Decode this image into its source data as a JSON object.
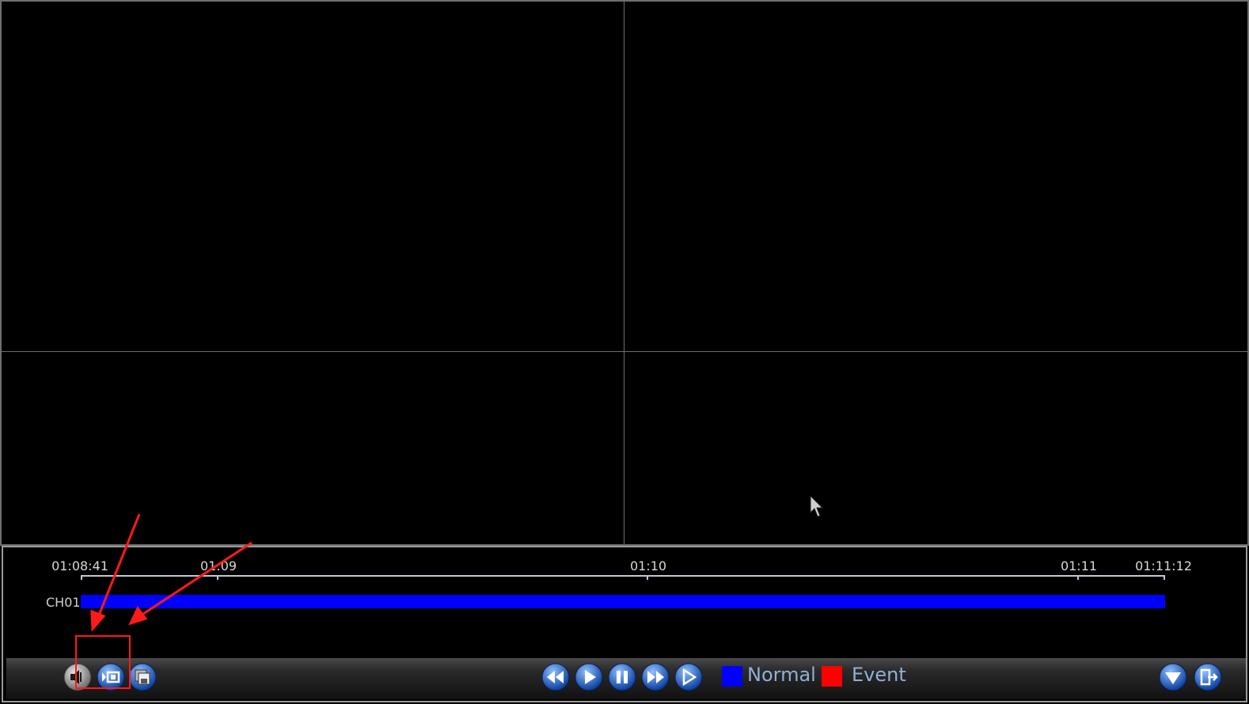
{
  "timeline": {
    "ticks": [
      "01:08:41",
      "01:09",
      "01:10",
      "01:11",
      "01:11:12"
    ],
    "channel_label": "CH01"
  },
  "legend": {
    "normal_label": "Normal",
    "event_label": "Event"
  },
  "colors": {
    "normal": "#0000ff",
    "event": "#ff0000",
    "annotation": "#ff1a1a",
    "button_blue": "#1e64c8"
  },
  "icons": {
    "left_group": [
      "speaker-icon",
      "clip-icon",
      "save-icon"
    ],
    "playback_group": [
      "rewind-icon",
      "play-icon",
      "pause-icon",
      "fast-forward-icon",
      "step-play-icon"
    ],
    "right_group": [
      "chevron-down-icon",
      "exit-icon"
    ]
  }
}
